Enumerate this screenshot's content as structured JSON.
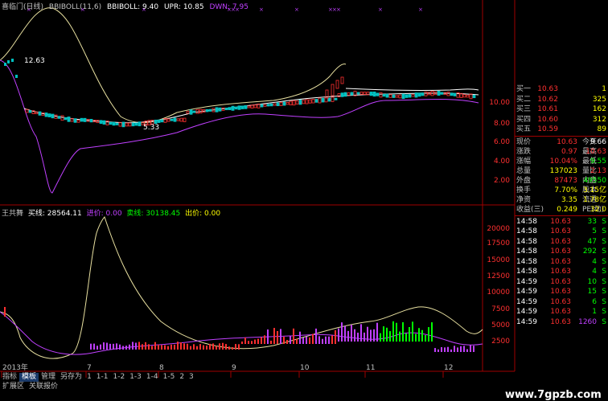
{
  "header": {
    "title": "喜临门(日线)",
    "indicator": "BBIBOLL(11,6)",
    "bbiboll": "BBIBOLL: 9.40",
    "upr": "UPR: 10.85",
    "dwn": "DWN: 7.95"
  },
  "price_axis": {
    "labels": [
      "10.00",
      "8.00",
      "6.00",
      "4.00",
      "2.00"
    ]
  },
  "annotation_high": "12.63",
  "annotation_low": "5.33",
  "lower_header": {
    "title": "王共舞",
    "buy": "买线: 28564.11",
    "jin": "进价: 0.00",
    "sell": "卖线: 30138.45",
    "chu": "出价: 0.00"
  },
  "lower_axis": {
    "labels": [
      "20000",
      "17500",
      "15000",
      "12500",
      "10000",
      "7500",
      "5000",
      "2500"
    ]
  },
  "time_axis": {
    "labels": [
      "2013年",
      "7",
      "8",
      "9",
      "10",
      "11",
      "12"
    ]
  },
  "orderbook": [
    {
      "name": "买一",
      "price": "10.63",
      "vol": "1"
    },
    {
      "name": "买二",
      "price": "10.62",
      "vol": "325"
    },
    {
      "name": "买三",
      "price": "10.61",
      "vol": "162"
    },
    {
      "name": "买四",
      "price": "10.60",
      "vol": "312"
    },
    {
      "name": "买五",
      "price": "10.59",
      "vol": "89"
    }
  ],
  "quote": [
    {
      "k1": "现价",
      "v1": "10.63",
      "k2": "今开",
      "v2": "9.66",
      "c1": "#ff3030",
      "c2": "#ffffff"
    },
    {
      "k1": "涨跌",
      "v1": "0.97",
      "k2": "最高",
      "v2": "10.63",
      "c1": "#ff3030",
      "c2": "#ff3030"
    },
    {
      "k1": "涨幅",
      "v1": "10.04%",
      "k2": "最低",
      "v2": "9.55",
      "c1": "#ff3030",
      "c2": "#00ff00"
    },
    {
      "k1": "总量",
      "v1": "137023",
      "k2": "量比",
      "v2": "2.13",
      "c1": "#ffff00",
      "c2": "#ff3030"
    },
    {
      "k1": "外盘",
      "v1": "87473",
      "k2": "内盘",
      "v2": "49550",
      "c1": "#ff3030",
      "c2": "#00ff00"
    },
    {
      "k1": "换手",
      "v1": "7.70%",
      "k2": "股本",
      "v2": "3.15亿",
      "c1": "#ffff00",
      "c2": "#ffff00"
    },
    {
      "k1": "净资",
      "v1": "3.35",
      "k2": "流通",
      "v2": "1.78亿",
      "c1": "#ffff00",
      "c2": "#ffff00"
    },
    {
      "k1": "收益(三)",
      "v1": "0.249",
      "k2": "PE(动)",
      "v2": "32.0",
      "c1": "#ffff00",
      "c2": "#ffff00"
    }
  ],
  "ticks": [
    {
      "time": "14:58",
      "price": "10.63",
      "vol": "33",
      "side": "S"
    },
    {
      "time": "14:58",
      "price": "10.63",
      "vol": "5",
      "side": "S"
    },
    {
      "time": "14:58",
      "price": "10.63",
      "vol": "47",
      "side": "S"
    },
    {
      "time": "14:58",
      "price": "10.63",
      "vol": "292",
      "side": "S"
    },
    {
      "time": "14:58",
      "price": "10.63",
      "vol": "4",
      "side": "S"
    },
    {
      "time": "14:58",
      "price": "10.63",
      "vol": "4",
      "side": "S"
    },
    {
      "time": "14:59",
      "price": "10.63",
      "vol": "10",
      "side": "S"
    },
    {
      "time": "14:59",
      "price": "10.63",
      "vol": "15",
      "side": "S"
    },
    {
      "time": "14:59",
      "price": "10.63",
      "vol": "6",
      "side": "S"
    },
    {
      "time": "14:59",
      "price": "10.63",
      "vol": "1",
      "side": "S"
    },
    {
      "time": "14:59",
      "price": "10.63",
      "vol": "1260",
      "side": "S"
    }
  ],
  "bottom_tabs": [
    "指标",
    "模板",
    "管理",
    "另存为",
    "1",
    "1-1",
    "1-2",
    "1-3",
    "1-4",
    "1-5",
    "2",
    "3"
  ],
  "bottom_tabs2": [
    "扩展区",
    "关联报价"
  ],
  "watermark": "www.7gpzb.com",
  "colors": {
    "up": "#ff3030",
    "down": "#00ff00",
    "accent": "#ffff00",
    "purple": "#c040ff"
  }
}
